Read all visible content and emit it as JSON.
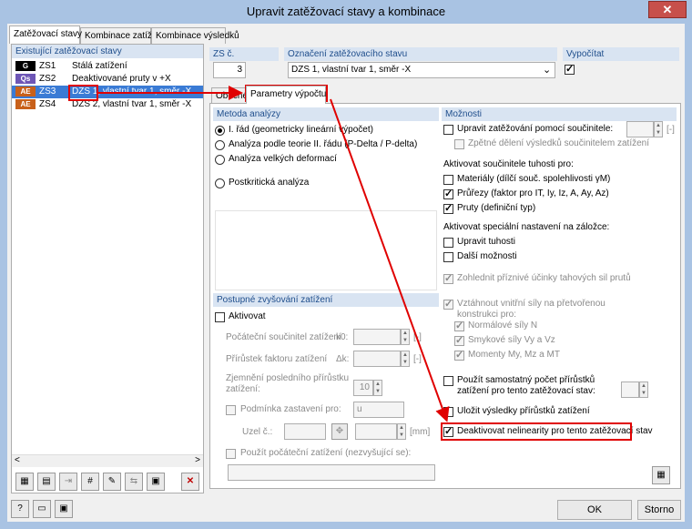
{
  "window": {
    "title": "Upravit zatěžovací stavy a kombinace",
    "close": "✕"
  },
  "tabs": [
    "Zatěžovací stavy",
    "Kombinace zatížení",
    "Kombinace výsledků"
  ],
  "left": {
    "header": "Existující zatěžovací stavy",
    "items": [
      {
        "badge": "G",
        "code": "ZS1",
        "name": "Stálá zatížení",
        "color": "#000000"
      },
      {
        "badge": "Qs",
        "code": "ZS2",
        "name": "Deaktivované pruty v +X",
        "color": "#6e56b6"
      },
      {
        "badge": "AE",
        "code": "ZS3",
        "name": "DZS 1, vlastní tvar 1, směr -X",
        "color": "#c8601a"
      },
      {
        "badge": "AE",
        "code": "ZS4",
        "name": "DZS 2, vlastní tvar 1, směr -X",
        "color": "#c8601a"
      }
    ]
  },
  "top": {
    "zs_label": "ZS č.",
    "zs_value": "3",
    "name_label": "Označení zatěžovacího stavu",
    "name_value": "DZS 1, vlastní tvar 1, směr -X",
    "calc_label": "Vypočítat"
  },
  "subtabs": [
    "Obecné",
    "Parametry výpočtu"
  ],
  "method": {
    "header": "Metoda analýzy",
    "options": [
      "I. řád (geometricky lineární výpočet)",
      "Analýza podle teorie II. řádu (P-Delta / P-delta)",
      "Analýza velkých deformací",
      "Postkritická analýza"
    ]
  },
  "incr": {
    "header": "Postupné zvyšování zatížení",
    "activate": "Aktivovat",
    "k0_label": "Počáteční součinitel zatížení",
    "k0_sym": "k0:",
    "unit": "[-]",
    "dk_label": "Přírůstek faktoru zatížení",
    "dk_sym": "Δk:",
    "refine_label1": "Zjemnění posledního přírůstku",
    "refine_label2": "zatížení:",
    "refine_value": "10",
    "stop_label": "Podmínka zastavení pro:",
    "stop_value": "u",
    "node_label": "Uzel č.:",
    "mm": "[mm]",
    "initial_label": "Použít počáteční zatížení (nezvyšující se):"
  },
  "options": {
    "header": "Možnosti",
    "coef_label": "Upravit zatěžování pomocí součinitele:",
    "coef_unit": "[-]",
    "split_label": "Zpětné dělení výsledků součinitelem zatížení",
    "activate_title": "Aktivovat součinitele tuhosti pro:",
    "materials": "Materiály (dílčí souč. spolehlivosti γM)",
    "sections": "Průřezy (faktor pro IT, Iy, Iz, A, Ay, Az)",
    "members": "Pruty (definiční typ)",
    "special_title": "Aktivovat speciální nastavení na záložce:",
    "stiffness": "Upravit tuhosti",
    "more": "Další možnosti",
    "tension": "Zohlednit příznivé účinky tahových sil prutů",
    "internal1": "Vztáhnout vnitřní síly na přetvořenou",
    "internal2": "konstrukci pro:",
    "normal": "Normálové síly N",
    "shear": "Smykové síly Vy a Vz",
    "moments": "Momenty My, Mz a MT",
    "own_count1": "Použít samostatný počet přírůstků",
    "own_count2": "zatížení pro tento zatěžovací stav:",
    "save_incr": "Uložit výsledky přírůstků zatížení",
    "deact_nl": "Deaktivovat nelinearity pro tento zatěžovací stav"
  },
  "footer": {
    "ok": "OK",
    "cancel": "Storno"
  },
  "scroll": {
    "left": "<",
    "right": ">"
  },
  "colors": {
    "accent": "#e00000",
    "selection": "#3a7bd5"
  }
}
